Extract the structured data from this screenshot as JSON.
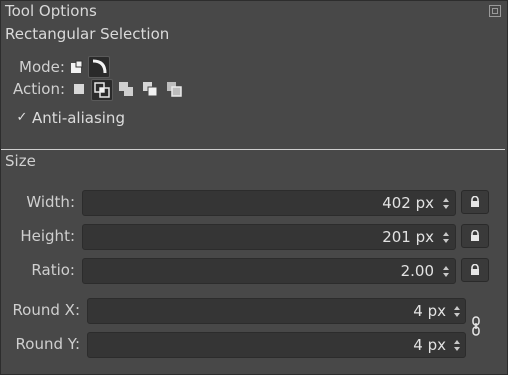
{
  "header": {
    "title": "Tool Options",
    "tool_name": "Rectangular Selection"
  },
  "mode": {
    "label": "Mode:",
    "icons": [
      "mode-replace-icon",
      "mode-rounded-icon"
    ]
  },
  "action": {
    "label": "Action:",
    "icons": [
      "action-replace-icon",
      "action-intersect-icon",
      "action-add-icon",
      "action-subtract-icon",
      "action-symmetric-icon"
    ]
  },
  "antialiasing": {
    "label": "Anti-aliasing",
    "checked": true,
    "check_glyph": "✓"
  },
  "size": {
    "label": "Size",
    "width": {
      "label": "Width:",
      "value": "402 px"
    },
    "height": {
      "label": "Height:",
      "value": "201 px"
    },
    "ratio": {
      "label": "Ratio:",
      "value": "2.00"
    }
  },
  "round": {
    "x": {
      "label": "Round X:",
      "value": "4 px"
    },
    "y": {
      "label": "Round Y:",
      "value": "4 px"
    }
  }
}
